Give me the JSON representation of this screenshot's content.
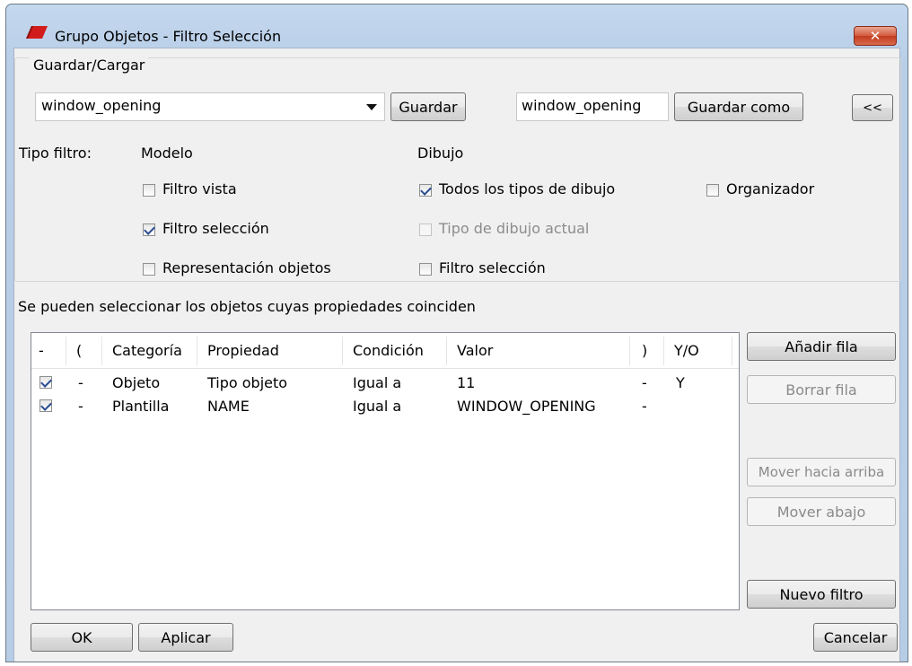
{
  "window": {
    "title": "Grupo Objetos - Filtro Selección"
  },
  "guardar": {
    "legend": "Guardar/Cargar",
    "combo_value": "window_opening",
    "save_label": "Guardar",
    "name_value": "window_opening",
    "save_as_label": "Guardar como",
    "collapse_label": "<<"
  },
  "filter": {
    "tipo_label": "Tipo filtro:",
    "modelo_label": "Modelo",
    "dibujo_label": "Dibujo",
    "filtro_vista": "Filtro vista",
    "filtro_seleccion": "Filtro selección",
    "representacion": "Representación objetos",
    "todos_tipos": "Todos los tipos de dibujo",
    "tipo_actual": "Tipo de dibujo actual",
    "dibujo_filtro_seleccion": "Filtro selección",
    "organizador": "Organizador"
  },
  "rules": {
    "caption": "Se pueden seleccionar los objetos cuyas propiedades coinciden",
    "columns": [
      "-",
      "(",
      "Categoría",
      "Propiedad",
      "Condición",
      "Valor",
      ")",
      "Y/O"
    ],
    "rows": [
      {
        "checked": true,
        "open": "-",
        "categoria": "Objeto",
        "propiedad": "Tipo objeto",
        "condicion": "Igual a",
        "valor": "11",
        "close": "-",
        "yo": "Y"
      },
      {
        "checked": true,
        "open": "-",
        "categoria": "Plantilla",
        "propiedad": "NAME",
        "condicion": "Igual a",
        "valor": "WINDOW_OPENING",
        "close": "-",
        "yo": ""
      }
    ]
  },
  "side_buttons": {
    "add_row": "Añadir fila",
    "delete_row": "Borrar fila",
    "move_up": "Mover hacia arriba",
    "move_down": "Mover abajo",
    "new_filter": "Nuevo filtro"
  },
  "footer": {
    "ok": "OK",
    "apply": "Aplicar",
    "cancel": "Cancelar"
  }
}
